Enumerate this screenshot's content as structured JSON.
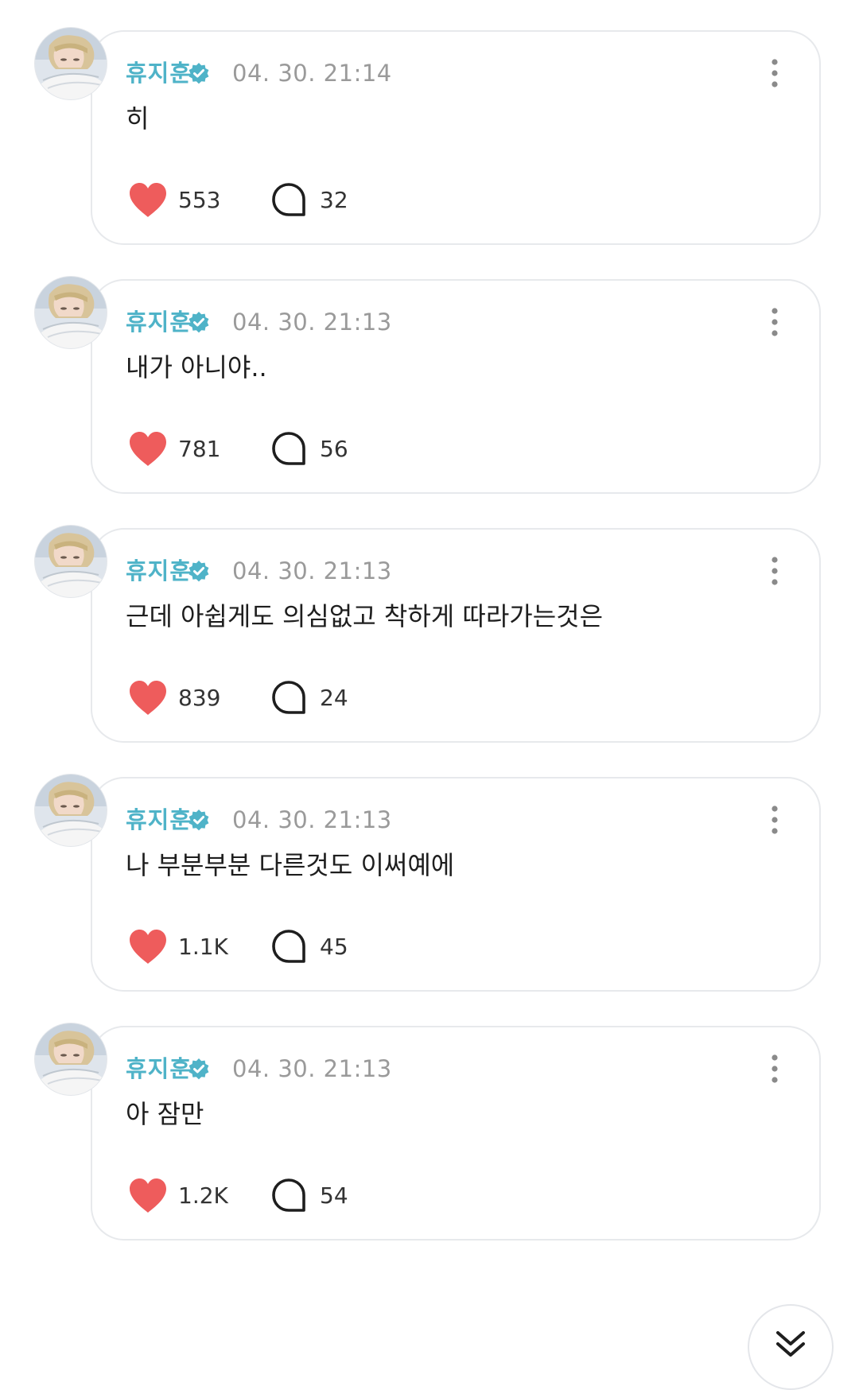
{
  "colors": {
    "name": "#4fb3c8",
    "verified_badge": "#4fb3c8",
    "heart": "#ee5c5c",
    "timestamp": "#9a9a9a",
    "card_border": "#e7e9ec"
  },
  "posts": [
    {
      "author": "휴지훈",
      "time": "04. 30. 21:14",
      "text": "히",
      "likes": "553",
      "comments": "32"
    },
    {
      "author": "휴지훈",
      "time": "04. 30. 21:13",
      "text": "내가 아니야..",
      "likes": "781",
      "comments": "56"
    },
    {
      "author": "휴지훈",
      "time": "04. 30. 21:13",
      "text": "근데 아쉽게도 의심없고 착하게 따라가는것은",
      "likes": "839",
      "comments": "24"
    },
    {
      "author": "휴지훈",
      "time": "04. 30. 21:13",
      "text": "나 부분부분 다른것도 이써예에",
      "likes": "1.1K",
      "comments": "45"
    },
    {
      "author": "휴지훈",
      "time": "04. 30. 21:13",
      "text": "아 잠만",
      "likes": "1.2K",
      "comments": "54"
    }
  ],
  "icons": {
    "verified": "verified-badge-icon",
    "like": "heart-icon",
    "comment": "comment-bubble-icon",
    "more": "more-vertical-icon",
    "scroll": "double-chevron-down-icon"
  }
}
